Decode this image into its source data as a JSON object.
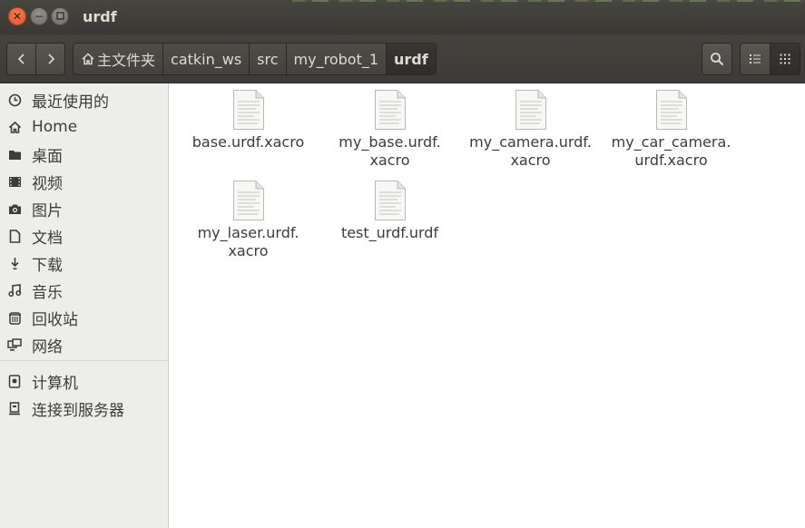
{
  "window": {
    "title": "urdf",
    "controls": [
      "close",
      "minimize",
      "maximize"
    ]
  },
  "toolbar": {
    "back_icon": "chevron-left-icon",
    "forward_icon": "chevron-right-icon",
    "breadcrumbs": [
      "主文件夹",
      "catkin_ws",
      "src",
      "my_robot_1",
      "urdf"
    ],
    "active_crumb": "urdf",
    "search_icon": "search-icon",
    "view_list_icon": "list-view-icon",
    "view_grid_icon": "grid-view-icon"
  },
  "sidebar": {
    "items": [
      {
        "label": "最近使用的",
        "icon": "clock-icon"
      },
      {
        "label": "Home",
        "icon": "home-icon"
      },
      {
        "label": "桌面",
        "icon": "folder-icon"
      },
      {
        "label": "视频",
        "icon": "video-icon"
      },
      {
        "label": "图片",
        "icon": "camera-icon"
      },
      {
        "label": "文档",
        "icon": "document-icon"
      },
      {
        "label": "下载",
        "icon": "download-icon"
      },
      {
        "label": "音乐",
        "icon": "music-icon"
      },
      {
        "label": "回收站",
        "icon": "trash-icon"
      },
      {
        "label": "网络",
        "icon": "network-icon"
      }
    ],
    "devices": [
      {
        "label": "计算机",
        "icon": "computer-icon"
      },
      {
        "label": "连接到服务器",
        "icon": "server-icon"
      }
    ]
  },
  "files": [
    {
      "name": "base.urdf.xacro"
    },
    {
      "name": "my_base.urdf.\nxacro"
    },
    {
      "name": "my_camera.urdf.\nxacro"
    },
    {
      "name": "my_car_camera.\nurdf.xacro"
    },
    {
      "name": "my_laser.urdf.\nxacro"
    },
    {
      "name": "test_urdf.urdf"
    }
  ]
}
